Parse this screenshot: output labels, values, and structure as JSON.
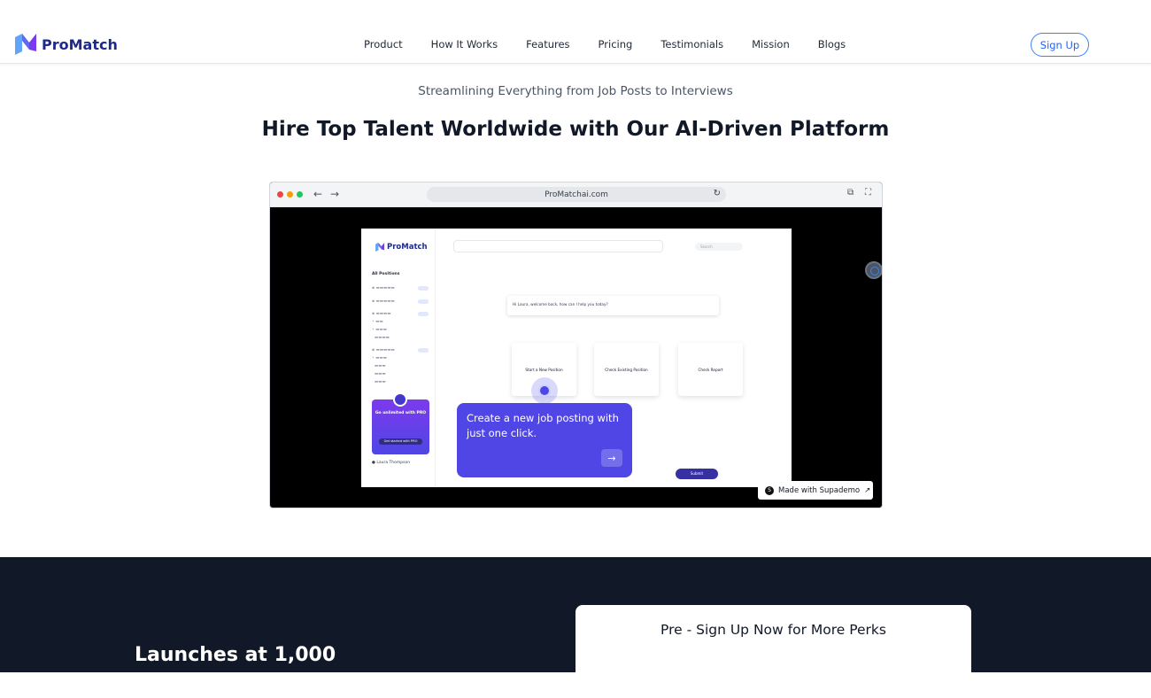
{
  "brand": {
    "name": "ProMatch"
  },
  "nav": {
    "links": [
      "Product",
      "How It Works",
      "Features",
      "Pricing",
      "Testimonials",
      "Mission",
      "Blogs"
    ],
    "signup_label": "Sign Up"
  },
  "hero": {
    "subtitle": "Streamlining Everything from Job Posts to Interviews",
    "headline": "Hire Top Talent Worldwide with Our AI-Driven Platform"
  },
  "demo": {
    "url": "ProMatchai.com",
    "app_brand": "ProMatch",
    "sidebar_header": "All Positions",
    "pro_card_title": "Go unlimited with PRO",
    "pro_card_button": "Get started with PRO",
    "user_name": "Laura Thompson",
    "search_placeholder": "Search",
    "chat_message": "Hi Laura, welcome back, how can I help you today?",
    "options": [
      "Start a New Position",
      "Check Existing Position",
      "Check Report"
    ],
    "submit_label": "Submit",
    "tooltip_text": "Create a new job posting with just one click.",
    "badge_text": "Made with Supademo"
  },
  "cta": {
    "launch_text": "Launches at 1,000",
    "form_title": "Pre - Sign Up Now for More Perks"
  },
  "colors": {
    "brand": "#1e2a8a",
    "accent": "#4f46e5",
    "dark_bg": "#111827"
  }
}
